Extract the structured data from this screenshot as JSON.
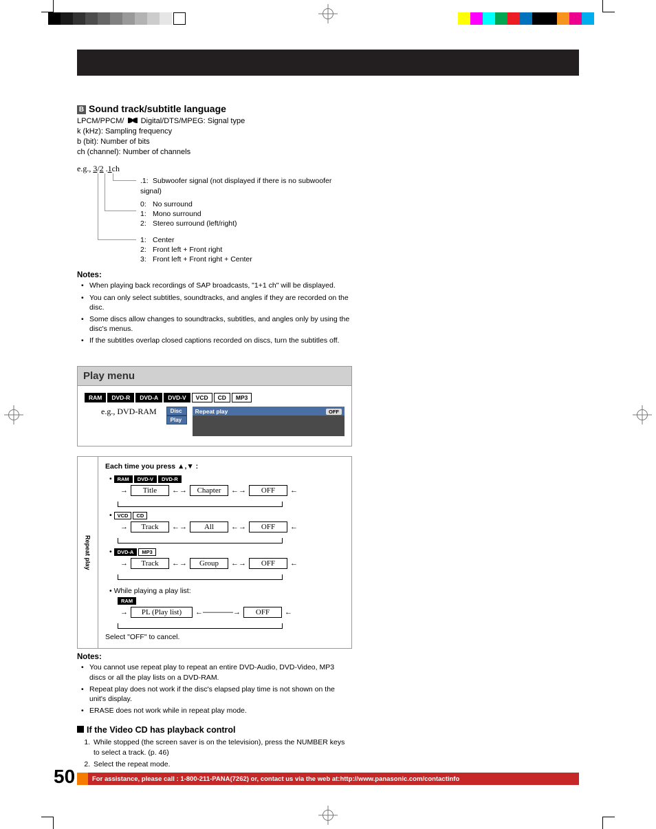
{
  "print_marks": {
    "left_swatches": [
      "#000000",
      "#1a1a1a",
      "#333333",
      "#4d4d4d",
      "#666666",
      "#808080",
      "#999999",
      "#b3b3b3",
      "#cccccc",
      "#e6e6e6"
    ],
    "right_swatches": [
      "#ffff00",
      "#ff00ff",
      "#00ffff",
      "#00a651",
      "#ed1c24",
      "#0072bc",
      "#000000",
      "#000000",
      "#f7941d",
      "#ec008c",
      "#00aeef"
    ]
  },
  "section_b": {
    "letter": "B",
    "title": "Sound track/subtitle language",
    "line1_a": "LPCM/PPCM/ ",
    "line1_b": " Digital/DTS/MPEG: Signal type",
    "line2": "k (kHz): Sampling frequency",
    "line3": "b (bit): Number of bits",
    "line4": "ch (channel): Number of channels",
    "eg_prefix": "e.g., ",
    "eg_a": "3",
    "eg_b": "/",
    "eg_c": "2",
    "eg_d": " .",
    "eg_e": "1",
    "eg_suffix": "ch",
    "def1_n": ".1:",
    "def1_t": "Subwoofer signal (not displayed if there is no subwoofer signal)",
    "def2a_n": "0:",
    "def2a_t": "No surround",
    "def2b_n": "1:",
    "def2b_t": "Mono surround",
    "def2c_n": "2:",
    "def2c_t": "Stereo surround (left/right)",
    "def3a_n": "1:",
    "def3a_t": "Center",
    "def3b_n": "2:",
    "def3b_t": "Front left + Front right",
    "def3c_n": "3:",
    "def3c_t": "Front left + Front right + Center",
    "notes_title": "Notes:",
    "note1": "When playing back recordings of SAP broadcasts, \"1+1 ch\" will be displayed.",
    "note2": "You can only select subtitles, soundtracks, and angles if they are recorded on the disc.",
    "note3": "Some discs allow changes to soundtracks, subtitles, and angles only by using the disc's menus.",
    "note4": "If the subtitles overlap closed captions recorded on discs, turn the subtitles off."
  },
  "play_menu": {
    "title": "Play menu",
    "badges": [
      "RAM",
      "DVD-R",
      "DVD-A",
      "DVD-V",
      "VCD",
      "CD",
      "MP3"
    ],
    "badge_bk": [
      true,
      true,
      true,
      true,
      false,
      false,
      false
    ],
    "eg": "e.g., DVD-RAM",
    "pill_disc": "Disc",
    "pill_play": "Play",
    "repeat_label": "Repeat play",
    "repeat_off": "OFF",
    "rp_side": "Repeat play",
    "each_time": "Each time you press ",
    "arrows": "▲,▼ :",
    "row1_badges": [
      "RAM",
      "DVD-V",
      "DVD-R"
    ],
    "row1_a": "Title",
    "row1_b": "Chapter",
    "row1_c": "OFF",
    "row2_badges": [
      "VCD",
      "CD"
    ],
    "row2_a": "Track",
    "row2_b": "All",
    "row2_c": "OFF",
    "row3_badges": [
      "DVD-A",
      "MP3"
    ],
    "row3_a": "Track",
    "row3_b": "Group",
    "row3_c": "OFF",
    "row4_label": "While playing a play list:",
    "row4_badges": [
      "RAM"
    ],
    "row4_a": "PL (Play list)",
    "row4_c": "OFF",
    "cancel": "Select \"OFF\" to cancel.",
    "notes_title": "Notes:",
    "pnote1": "You cannot use repeat play to repeat an entire DVD-Audio, DVD-Video, MP3 discs or all the play lists on a DVD-RAM.",
    "pnote2": "Repeat play does not work if the disc's elapsed play time is not shown on the unit's display.",
    "pnote3": "ERASE does not work while in repeat play mode."
  },
  "vcd_section": {
    "title": "If the Video CD has playback control",
    "step1": "While stopped (the screen saver is on the television), press the NUMBER keys to select a track. (p. 46)",
    "step2": "Select the repeat mode."
  },
  "footer": {
    "page_num": "50",
    "text": "For assistance, please call : 1-800-211-PANA(7262) or, contact us via the web at:http://www.panasonic.com/contactinfo"
  }
}
